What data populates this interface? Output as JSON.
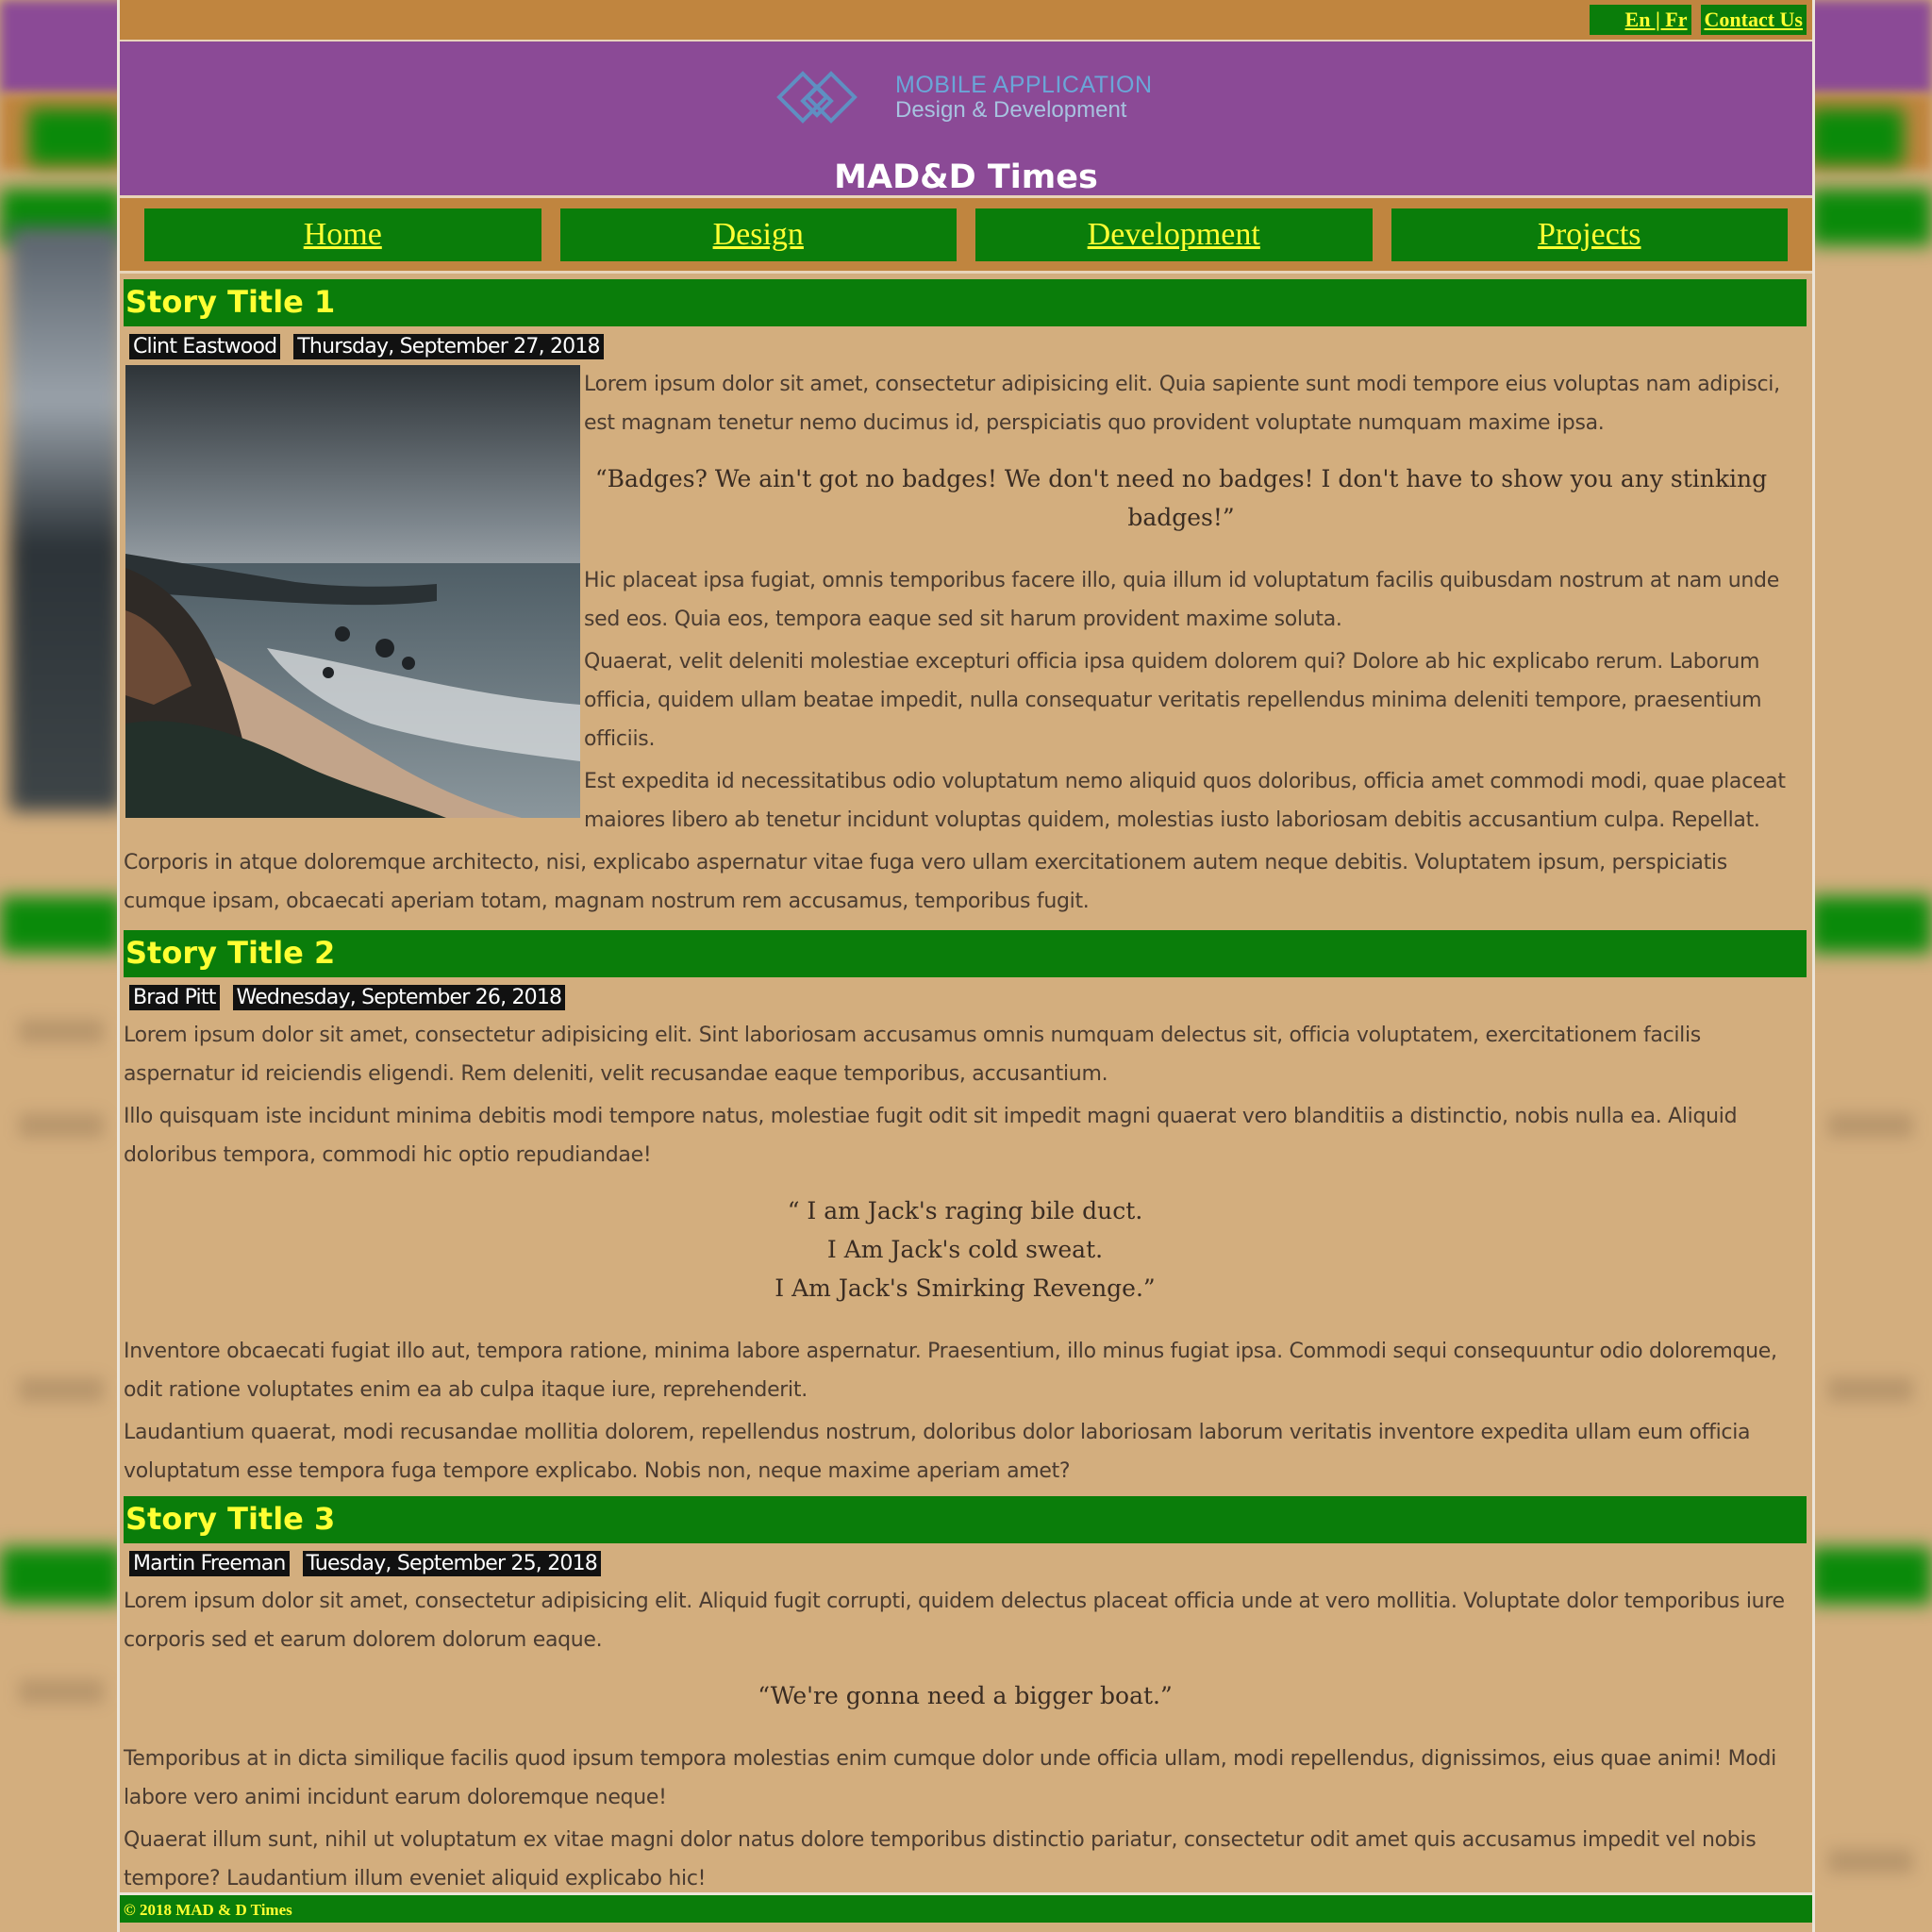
{
  "topbar": {
    "lang_link": "En | Fr",
    "contact_link": "Contact Us"
  },
  "logo": {
    "line1": "MOBILE APPLICATION",
    "line2": "Design & Development"
  },
  "site_title": "MAD&D Times",
  "nav": [
    "Home",
    "Design",
    "Development",
    "Projects"
  ],
  "stories": [
    {
      "title": "Story Title 1",
      "author": "Clint Eastwood",
      "date": "Thursday, September 27, 2018",
      "p1": "Lorem ipsum dolor sit amet, consectetur adipisicing elit. Quia sapiente sunt modi tempore eius voluptas nam adipisci, est magnam tenetur nemo ducimus id, perspiciatis quo provident voluptate numquam maxime ipsa.",
      "quote": "“Badges? We ain't got no badges! We don't need no badges! I don't have to show you any stinking badges!”",
      "p2": "Hic placeat ipsa fugiat, omnis temporibus facere illo, quia illum id voluptatum facilis quibusdam nostrum at nam unde sed eos. Quia eos, tempora eaque sed sit harum provident maxime soluta.",
      "p3": "Quaerat, velit deleniti molestiae excepturi officia ipsa quidem dolorem qui? Dolore ab hic explicabo rerum. Laborum officia, quidem ullam beatae impedit, nulla consequatur veritatis repellendus minima deleniti tempore, praesentium officiis.",
      "p4": "Est expedita id necessitatibus odio voluptatum nemo aliquid quos doloribus, officia amet commodi modi, quae placeat maiores libero ab tenetur incidunt voluptas quidem, molestias iusto laboriosam debitis accusantium culpa. Repellat.",
      "p5": "Corporis in atque doloremque architecto, nisi, explicabo aspernatur vitae fuga vero ullam exercitationem autem neque debitis. Voluptatem ipsum, perspiciatis cumque ipsam, obcaecati aperiam totam, magnam nostrum rem accusamus, temporibus fugit."
    },
    {
      "title": "Story Title 2",
      "author": "Brad Pitt",
      "date": "Wednesday, September 26, 2018",
      "p1": "Lorem ipsum dolor sit amet, consectetur adipisicing elit. Sint laboriosam accusamus omnis numquam delectus sit, officia voluptatem, exercitationem facilis aspernatur id reiciendis eligendi. Rem deleniti, velit recusandae eaque temporibus, accusantium.",
      "p2": "Illo quisquam iste incidunt minima debitis modi tempore natus, molestiae fugit odit sit impedit magni quaerat vero blanditiis a distinctio, nobis nulla ea. Aliquid doloribus tempora, commodi hic optio repudiandae!",
      "quote_line1": "“ I am Jack's raging bile duct.",
      "quote_line2": "I Am Jack's cold sweat.",
      "quote_line3": "I Am Jack's Smirking Revenge.”",
      "p3": "Inventore obcaecati fugiat illo aut, tempora ratione, minima labore aspernatur. Praesentium, illo minus fugiat ipsa. Commodi sequi consequuntur odio doloremque, odit ratione voluptates enim ea ab culpa itaque iure, reprehenderit.",
      "p4": "Laudantium quaerat, modi recusandae mollitia dolorem, repellendus nostrum, doloribus dolor laboriosam laborum veritatis inventore expedita ullam eum officia voluptatum esse tempora fuga tempore explicabo. Nobis non, neque maxime aperiam amet?"
    },
    {
      "title": "Story Title 3",
      "author": "Martin Freeman",
      "date": "Tuesday, September 25, 2018",
      "p1": "Lorem ipsum dolor sit amet, consectetur adipisicing elit. Aliquid fugit corrupti, quidem delectus placeat officia unde at vero mollitia. Voluptate dolor temporibus iure corporis sed et earum dolorem dolorum eaque.",
      "quote": "“We're gonna need a bigger boat.”",
      "p2": "Temporibus at in dicta similique facilis quod ipsum tempora molestias enim cumque dolor unde officia ullam, modi repellendus, dignissimos, eius quae animi! Modi labore vero animi incidunt earum doloremque neque!",
      "p3": "Quaerat illum sunt, nihil ut voluptatum ex vitae magni dolor natus dolore temporibus distinctio pariatur, consectetur odit amet quis accusamus impedit vel nobis tempore? Laudantium illum eveniet aliquid explicabo hic!"
    }
  ],
  "footer": "© 2018 MAD & D Times",
  "colors": {
    "purple": "#8b4a96",
    "orange": "#c0853f",
    "green": "#0a7d0a",
    "yellow": "#ffff33",
    "tan": "#d3ae7e"
  }
}
